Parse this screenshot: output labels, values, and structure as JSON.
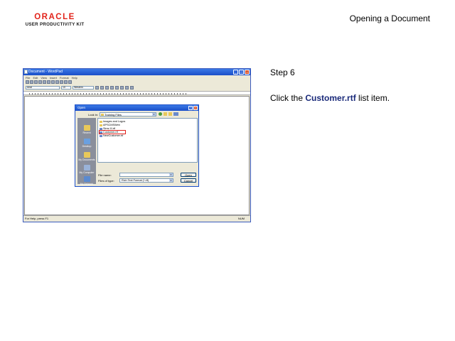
{
  "header": {
    "logo_brand": "ORACLE",
    "logo_sub": "USER PRODUCTIVITY KIT",
    "page_title": "Opening a Document"
  },
  "step": {
    "label": "Step 6",
    "instruction_prefix": "Click the ",
    "instruction_target": "Customer.rtf",
    "instruction_suffix": " list item."
  },
  "screenshot": {
    "window_title": "Document - WordPad",
    "menu": [
      "File",
      "Edit",
      "View",
      "Insert",
      "Format",
      "Help"
    ],
    "font_name": "Arial",
    "font_size": "10",
    "script": "Western",
    "status_text": "For Help, press F1",
    "status_num": "NUM",
    "dialog": {
      "title": "Open",
      "look_in_label": "Look in:",
      "look_in_value": "Training Files",
      "places": [
        "Recent",
        "Desktop",
        "My Documents",
        "My Computer",
        "My Network"
      ],
      "files": [
        "Images and Logos",
        "APSCMSWeb",
        "Sims III.rtf",
        "Customer.rtf",
        "NewCustomer.rtf"
      ],
      "file_name_label": "File name:",
      "file_name_value": "",
      "file_type_label": "Files of type:",
      "file_type_value": "Rich Text Format (*.rtf)",
      "open_label": "Open",
      "cancel_label": "Cancel"
    }
  },
  "colors": {
    "brand_red": "#e2231a",
    "highlight_text": "#1a2a7a",
    "highlight_box": "#e0201a"
  }
}
